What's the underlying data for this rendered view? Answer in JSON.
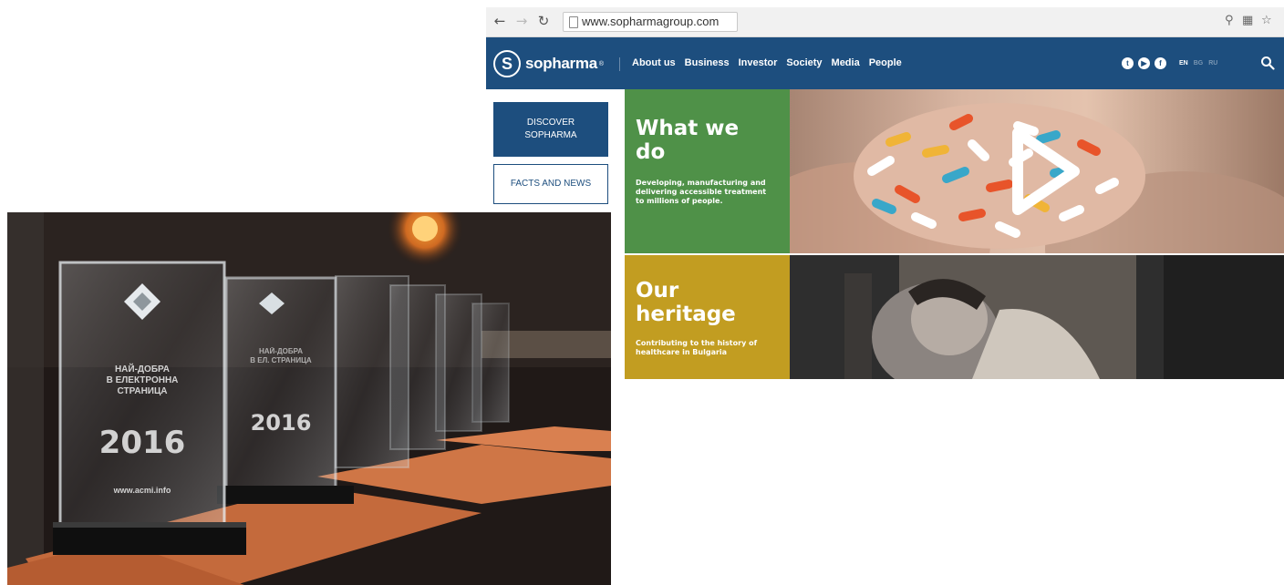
{
  "browser": {
    "nav_icons": [
      "back-arrow-icon",
      "forward-arrow-icon",
      "reload-icon"
    ],
    "address_bar": {
      "url": "www.sopharmagroup.com"
    },
    "toolbar_icons": [
      "zoom-icon",
      "translate-icon",
      "bookmark-star-icon"
    ]
  },
  "site": {
    "logo": {
      "mark": "S",
      "text": "sopharma",
      "sup": "®"
    },
    "nav": [
      "About us",
      "Business",
      "Investor",
      "Society",
      "Media",
      "People"
    ],
    "social": [
      {
        "icon": "twitter-icon",
        "glyph": "t"
      },
      {
        "icon": "youtube-icon",
        "glyph": "▶"
      },
      {
        "icon": "facebook-icon",
        "glyph": "f"
      }
    ],
    "languages": [
      "EN",
      "BG",
      "RU"
    ],
    "active_language": "EN",
    "colors": {
      "header": "#1d4e7e",
      "green_tile": "#4f9148",
      "gold_tile": "#c29d21"
    }
  },
  "sidebar": {
    "discover_line1": "DISCOVER",
    "discover_line2": "SOPHARMA",
    "facts": "FACTS AND NEWS"
  },
  "tiles": {
    "what_we_do": {
      "title_line1": "What we",
      "title_line2": "do",
      "text": "Developing, manufacturing and delivering accessible treatment to millions of people."
    },
    "heritage": {
      "title_line1": "Our",
      "title_line2": "heritage",
      "text": "Contributing to the history of healthcare in Bulgaria"
    }
  },
  "photo": {
    "trophy_front": {
      "heading": "НАЙ-ДОБРА\nВ ЕЛЕКТРОННА\nСТРАНИЦА",
      "year": "2016",
      "website": "www.acmi.info"
    },
    "trophy_back": {
      "heading": "НАЙ-ДОБРА\nВ ЕЛ. СТРАНИЦА",
      "year": "2016"
    }
  }
}
